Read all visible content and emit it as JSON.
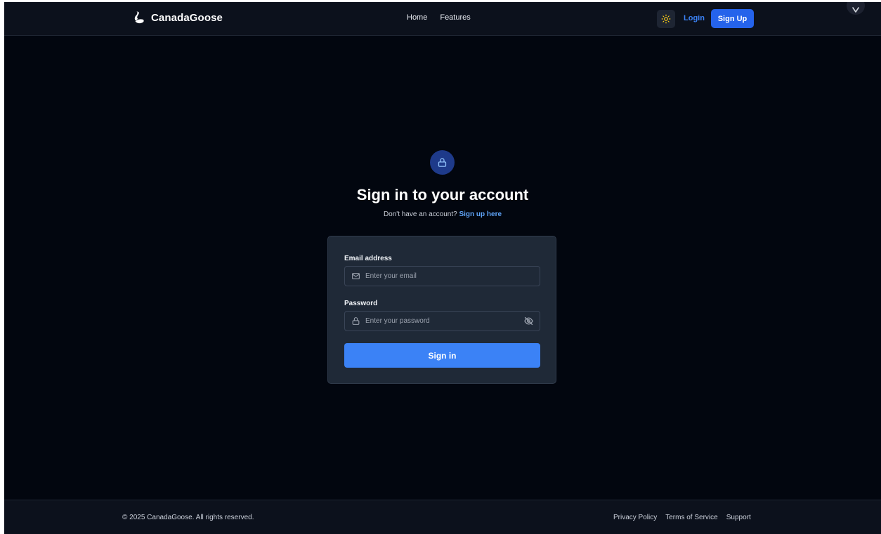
{
  "header": {
    "brand_name": "CanadaGoose",
    "brand_icon": "swan-icon",
    "nav": [
      {
        "label": "Home"
      },
      {
        "label": "Features"
      }
    ],
    "theme_toggle_icon": "sun-icon",
    "login_label": "Login",
    "signup_label": "Sign Up",
    "corner_badge_icon": "chevron-down-icon"
  },
  "main": {
    "badge_icon": "lock-icon",
    "title": "Sign in to your account",
    "subtitle_prefix": "Don't have an account?",
    "subtitle_link": "Sign up here",
    "form": {
      "email_label": "Email address",
      "email_placeholder": "Enter your email",
      "email_value": "",
      "email_icon": "mail-icon",
      "password_label": "Password",
      "password_placeholder": "Enter your password",
      "password_value": "",
      "password_icon": "lock-icon",
      "password_toggle_icon": "eye-off-icon",
      "submit_label": "Sign in"
    }
  },
  "footer": {
    "copyright": "© 2025 CanadaGoose. All rights reserved.",
    "links": [
      {
        "label": "Privacy Policy"
      },
      {
        "label": "Terms of Service"
      },
      {
        "label": "Support"
      }
    ]
  },
  "colors": {
    "background": "#02060f",
    "header_bg": "#0c111c",
    "card_bg": "#1f2937",
    "accent": "#3b82f6",
    "signup_bg": "#2563eb",
    "link": "#60a5fa",
    "sun": "#facc15"
  }
}
